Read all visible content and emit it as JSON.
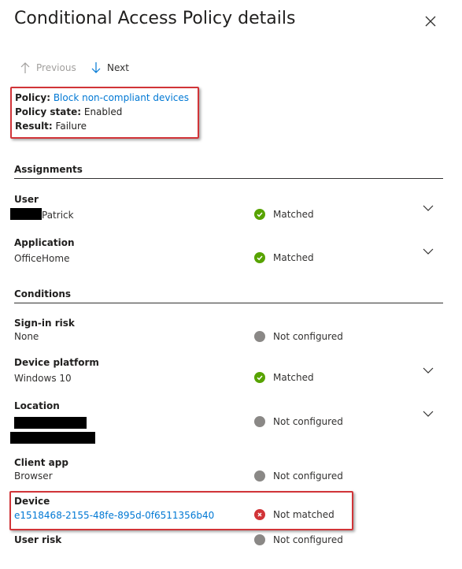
{
  "panel": {
    "title": "Conditional Access Policy details",
    "nav": {
      "previous_label": "Previous",
      "next_label": "Next"
    }
  },
  "policy": {
    "policy_label": "Policy:",
    "policy_name": "Block non-compliant devices",
    "state_label": "Policy state:",
    "state_value": "Enabled",
    "result_label": "Result:",
    "result_value": "Failure"
  },
  "assignments": {
    "title": "Assignments",
    "rows": [
      {
        "title": "User",
        "value": "Patrick",
        "status": "Matched"
      },
      {
        "title": "Application",
        "value": "OfficeHome",
        "status": "Matched"
      }
    ]
  },
  "conditions": {
    "title": "Conditions",
    "rows": [
      {
        "title": "Sign-in risk",
        "value": "None",
        "status": "Not configured"
      },
      {
        "title": "Device platform",
        "value": "Windows 10",
        "status": "Matched"
      },
      {
        "title": "Location",
        "value": "",
        "status": "Not configured"
      },
      {
        "title": "Client app",
        "value": "Browser",
        "status": "Not configured"
      },
      {
        "title": "Device",
        "value": "e1518468-2155-48fe-895d-0f6511356b40",
        "status": "Not matched"
      },
      {
        "title": "User risk",
        "value": "",
        "status": "Not configured"
      }
    ]
  },
  "colors": {
    "matched": "#57a300",
    "not_configured": "#8a8886",
    "not_matched": "#d13438",
    "link": "#0078d4",
    "highlight": "#d13438"
  },
  "icons": {
    "close": "close-icon",
    "previous": "arrow-up-icon",
    "next": "arrow-down-icon",
    "expand": "chevron-down-icon",
    "matched": "check-circle-icon",
    "not_configured": "gray-dot-icon",
    "not_matched": "error-circle-icon"
  }
}
